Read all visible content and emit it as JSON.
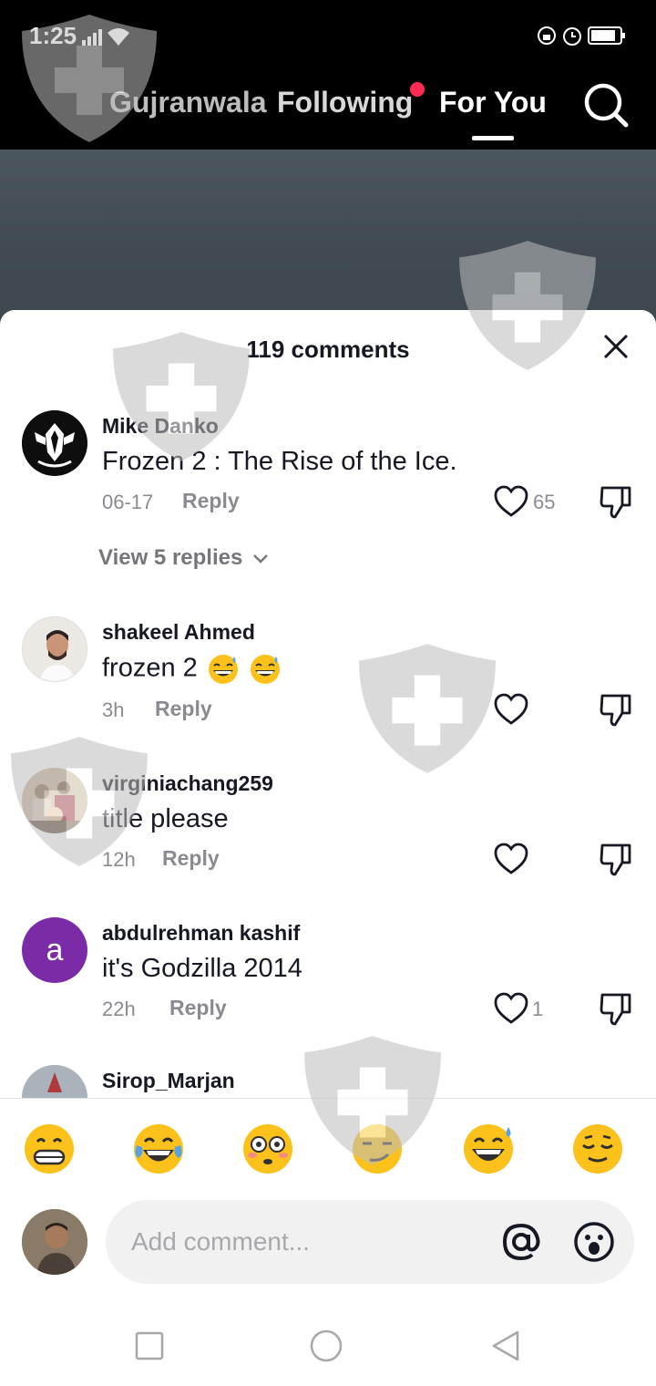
{
  "status": {
    "time": "1:25"
  },
  "tabs": {
    "nearby": "Gujranwala",
    "following": "Following",
    "for_you": "For You"
  },
  "comments_panel": {
    "title": "119 comments"
  },
  "comments": [
    {
      "username": "Mike Danko",
      "text": "Frozen 2 : The Rise of the Ice.",
      "time": "06-17",
      "reply": "Reply",
      "likes": "65",
      "view_replies": "View 5 replies"
    },
    {
      "username": "shakeel Ahmed",
      "text": "frozen 2",
      "time": "3h",
      "reply": "Reply",
      "likes": ""
    },
    {
      "username": "virginiachang259",
      "text": "title please",
      "time": "12h",
      "reply": "Reply",
      "likes": ""
    },
    {
      "username": "abdulrehman kashif",
      "avatar_letter": "a",
      "text": "it's Godzilla 2014",
      "time": "22h",
      "reply": "Reply",
      "likes": "1"
    },
    {
      "username": "Sirop_Marjan"
    }
  ],
  "emoji_bar": [
    "grinning-face",
    "tears-of-joy",
    "flushed-face",
    "smirking-face",
    "sweat-smile",
    "relieved-face"
  ],
  "input": {
    "placeholder": "Add comment..."
  },
  "colors": {
    "accent_red": "#fe2c55",
    "avatar_purple": "#7b2ba5",
    "text_dark": "#161823",
    "text_gray": "#8a8b91"
  }
}
